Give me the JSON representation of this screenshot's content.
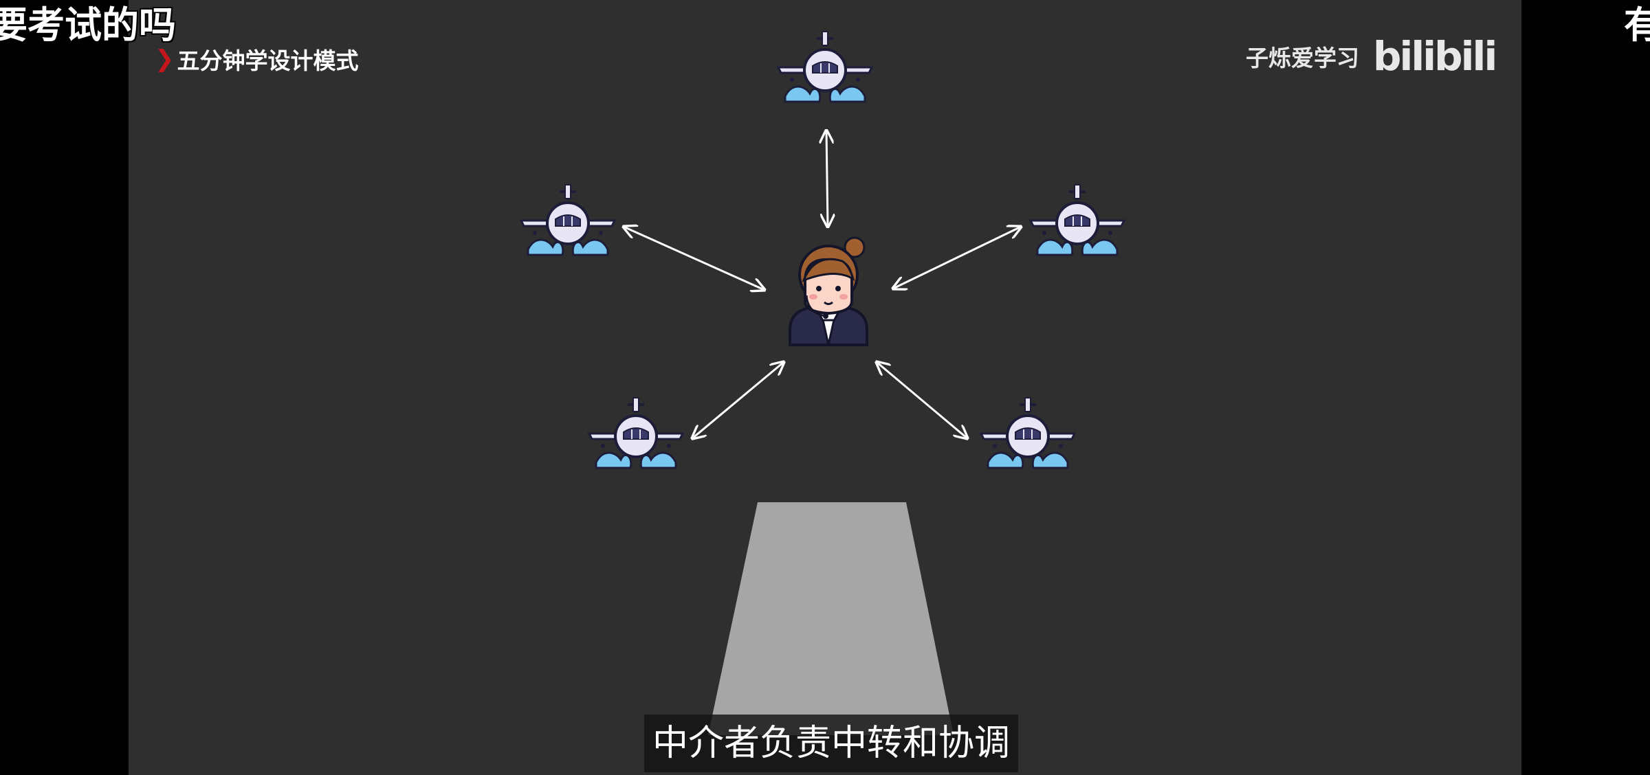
{
  "danmaku": {
    "left_text": "要考试的吗",
    "right_text": "有"
  },
  "video": {
    "series_title": "五分钟学设计模式",
    "channel_name": "子烁爱学习",
    "platform_logo": "bilibili",
    "subtitle": "中介者负责中转和协调"
  },
  "icons": {
    "chevron": "chevron-right-icon",
    "controller": "air-traffic-controller-icon",
    "airplane": "airplane-icon"
  },
  "colors": {
    "background": "#2f2f2f",
    "chevron": "#c4161c",
    "water": "#7ac8f2",
    "runway": "#a6a6a6"
  }
}
